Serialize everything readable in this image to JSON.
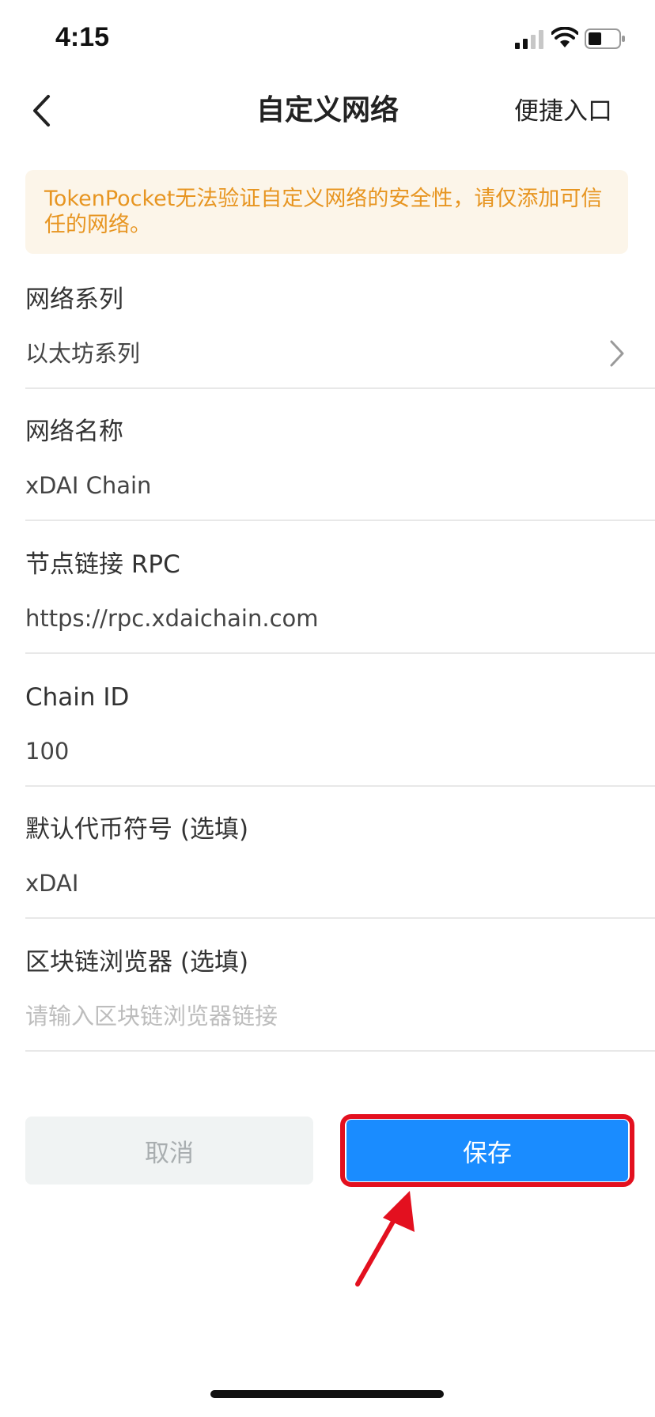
{
  "status_bar": {
    "time": "4:15"
  },
  "nav": {
    "title": "自定义网络",
    "right_action": "便捷入口"
  },
  "warning": {
    "text": "TokenPocket无法验证自定义网络的安全性，请仅添加可信任的网络。"
  },
  "fields": {
    "network_series": {
      "label": "网络系列",
      "value": "以太坊系列"
    },
    "network_name": {
      "label": "网络名称",
      "value": "xDAI Chain"
    },
    "rpc": {
      "label": "节点链接 RPC",
      "value": "https://rpc.xdaichain.com"
    },
    "chain_id": {
      "label": "Chain ID",
      "value": "100"
    },
    "symbol": {
      "label": "默认代币符号 (选填)",
      "value": "xDAI"
    },
    "explorer": {
      "label": "区块链浏览器 (选填)",
      "value": "",
      "placeholder": "请输入区块链浏览器链接"
    }
  },
  "buttons": {
    "cancel": "取消",
    "save": "保存"
  },
  "colors": {
    "warning_text": "#e79521",
    "warning_bg": "#fcf5e9",
    "primary": "#1a8cff",
    "highlight": "#e3101f"
  }
}
